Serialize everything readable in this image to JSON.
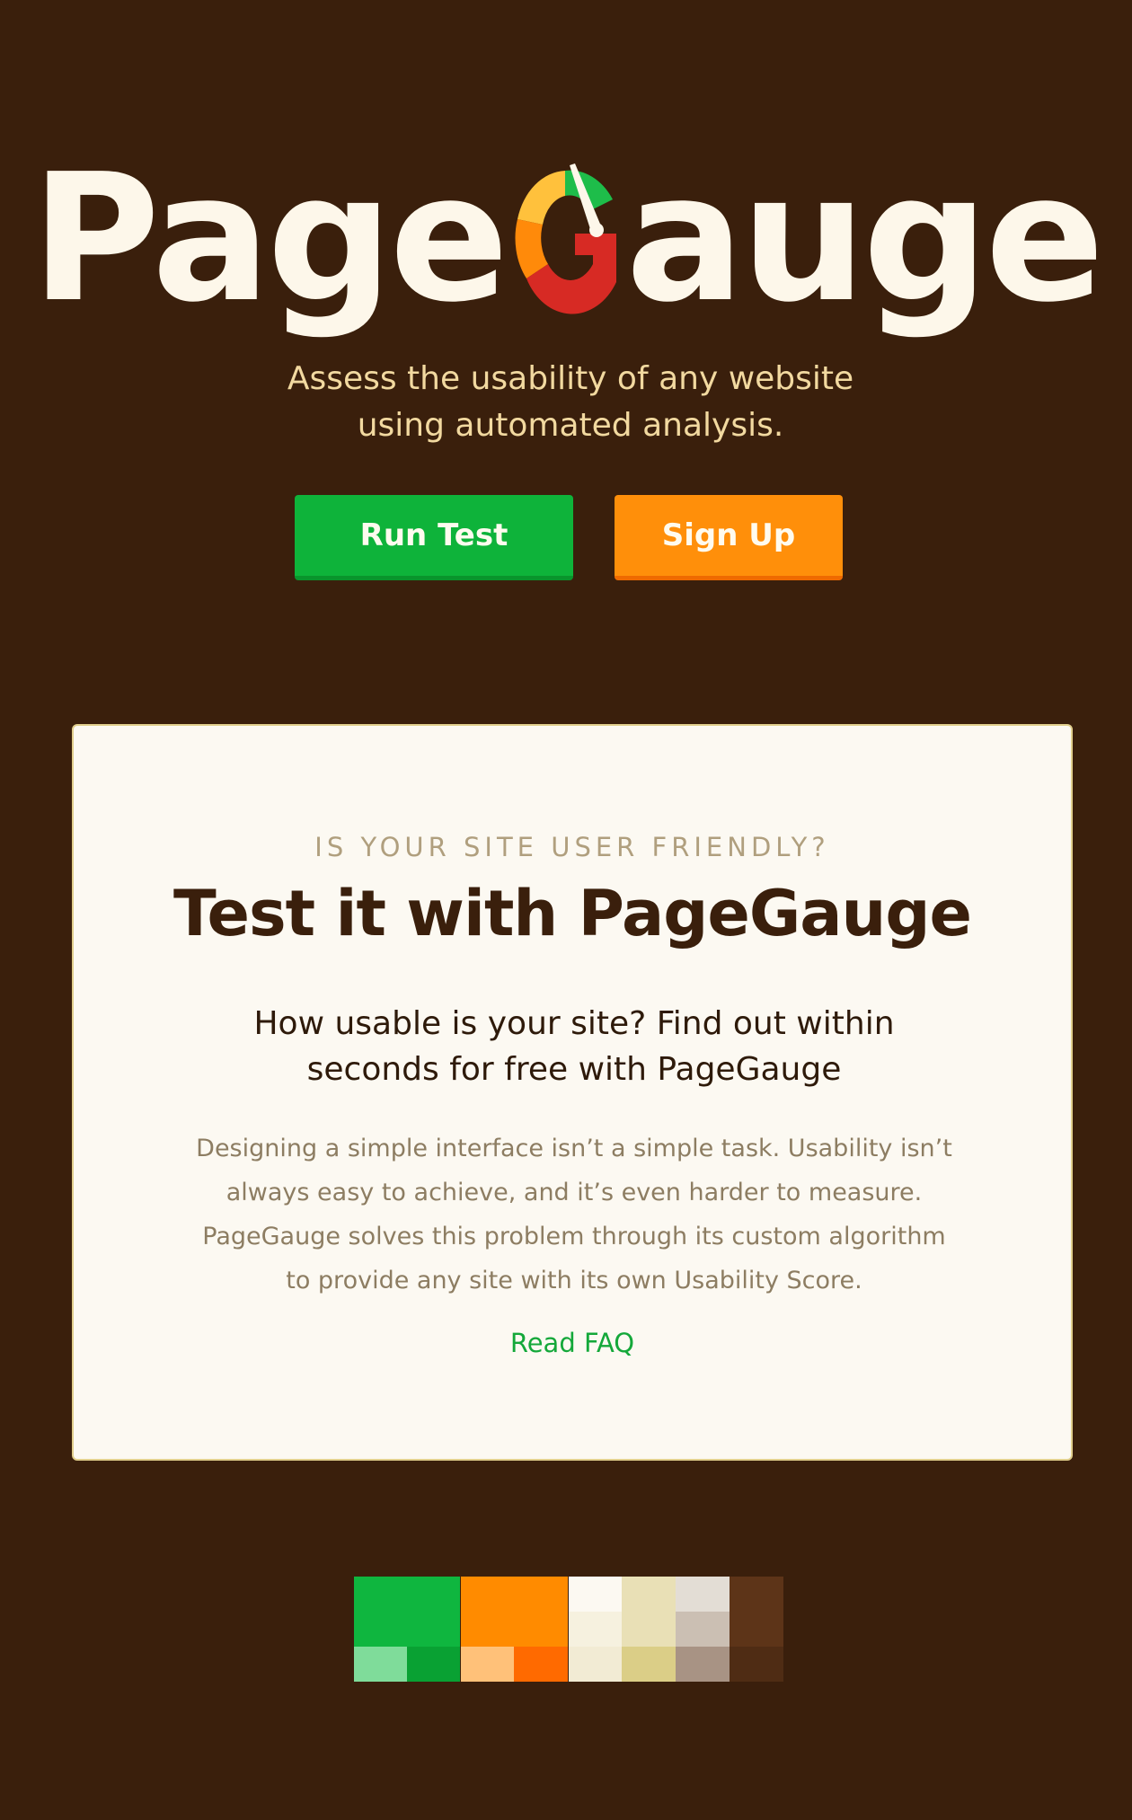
{
  "logo": {
    "left_text": "Page",
    "right_text": "auge",
    "gauge_colors": [
      "#1ebd4a",
      "#ffc13c",
      "#ff8a0a",
      "#d72a24"
    ],
    "needle_color": "#fdf7ea"
  },
  "tagline": {
    "line1": "Assess the usability of any website",
    "line2": "using automated analysis."
  },
  "buttons": {
    "run_test": "Run Test",
    "sign_up": "Sign Up"
  },
  "card": {
    "eyebrow": "IS YOUR SITE USER FRIENDLY?",
    "title": "Test it with PageGauge",
    "subtitle_line1": "How usable is your site? Find out within",
    "subtitle_line2": "seconds for free with PageGauge",
    "body_line1": "Designing a simple interface isn’t a simple task. Usability isn’t",
    "body_line2": "always easy to achieve, and it’s even harder to measure.",
    "body_line3": "PageGauge solves this problem through its custom algorithm",
    "body_line4": "to provide any site with its own Usability Score.",
    "faq_link": "Read FAQ"
  },
  "palette": {
    "green": [
      "#0fb63f",
      "#7fdc9a",
      "#09a133"
    ],
    "orange": [
      "#ff8b00",
      "#ffc179",
      "#ff6a00"
    ],
    "cream": [
      "#fcf9f2",
      "#f6f1df",
      "#f2ebd4"
    ],
    "khaki": [
      "#e9e0b6",
      "#dbce87"
    ],
    "greige": [
      "#e3ddd5",
      "#cbbfb3",
      "#a89384"
    ],
    "brown": [
      "#5d3418",
      "#4f2c14"
    ]
  }
}
